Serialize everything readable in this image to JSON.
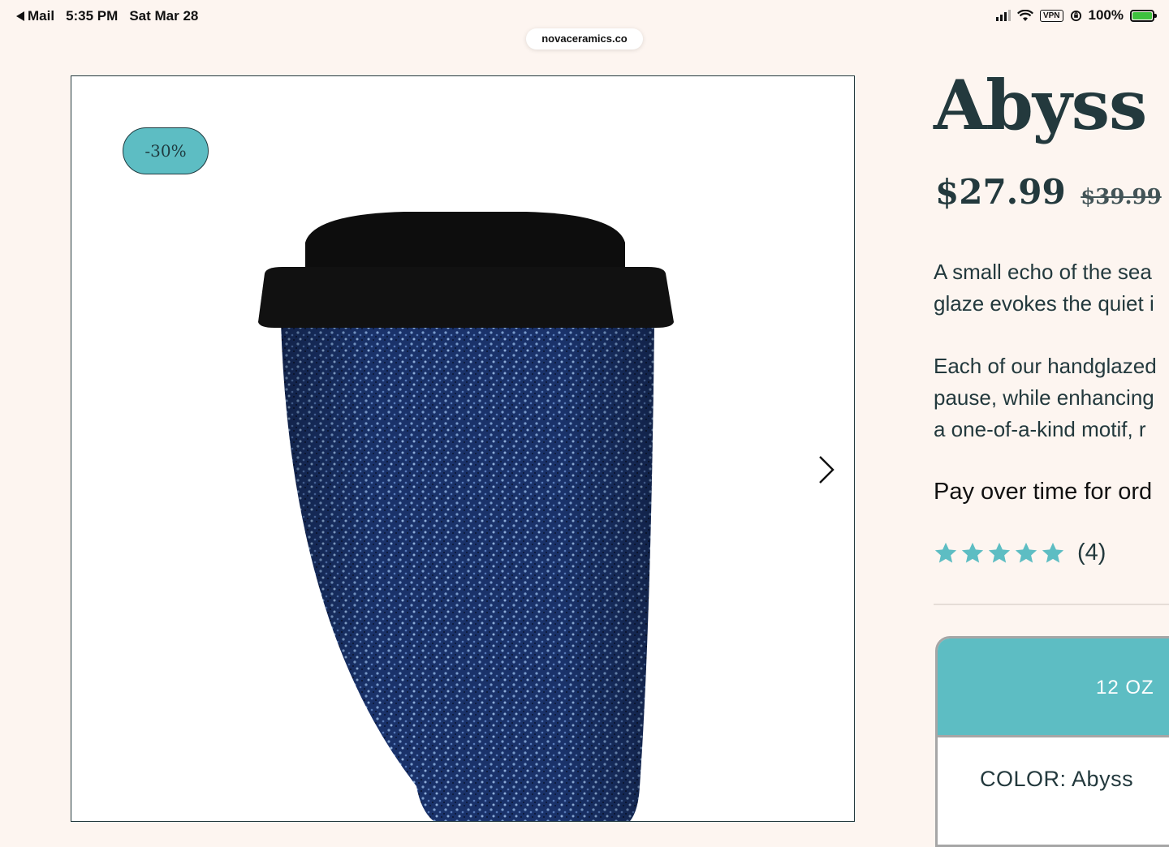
{
  "status_bar": {
    "back_app": "Mail",
    "time": "5:35 PM",
    "date": "Sat Mar 28",
    "vpn": "VPN",
    "battery": "100%",
    "battery_level": 1.0
  },
  "browser": {
    "url": "novaceramics.co"
  },
  "gallery": {
    "discount_badge": "-30%",
    "image_icon": "glazed-travel-cup",
    "next_icon": "chevron-right-icon"
  },
  "product": {
    "title": "Abyss",
    "price": "$27.99",
    "old_price": "$39.99",
    "description_1_line_1": "A small echo of the sea",
    "description_1_line_2": "glaze evokes the quiet i",
    "description_2_line_1": "Each of our handglazed",
    "description_2_line_2": "pause, while enhancing",
    "description_2_line_3": "a one-of-a-kind motif, r",
    "pay_over_time": "Pay over time for ord",
    "rating_stars": 5,
    "review_count": "(4)",
    "size_option": "12 OZ",
    "color_label": "COLOR:",
    "color_value": "Abyss"
  },
  "colors": {
    "background": "#fdf5f0",
    "accent": "#5dbdc3",
    "text_dark": "#23393d",
    "cup_glaze": "#1b3570",
    "cup_lid": "#0d0d0d"
  }
}
